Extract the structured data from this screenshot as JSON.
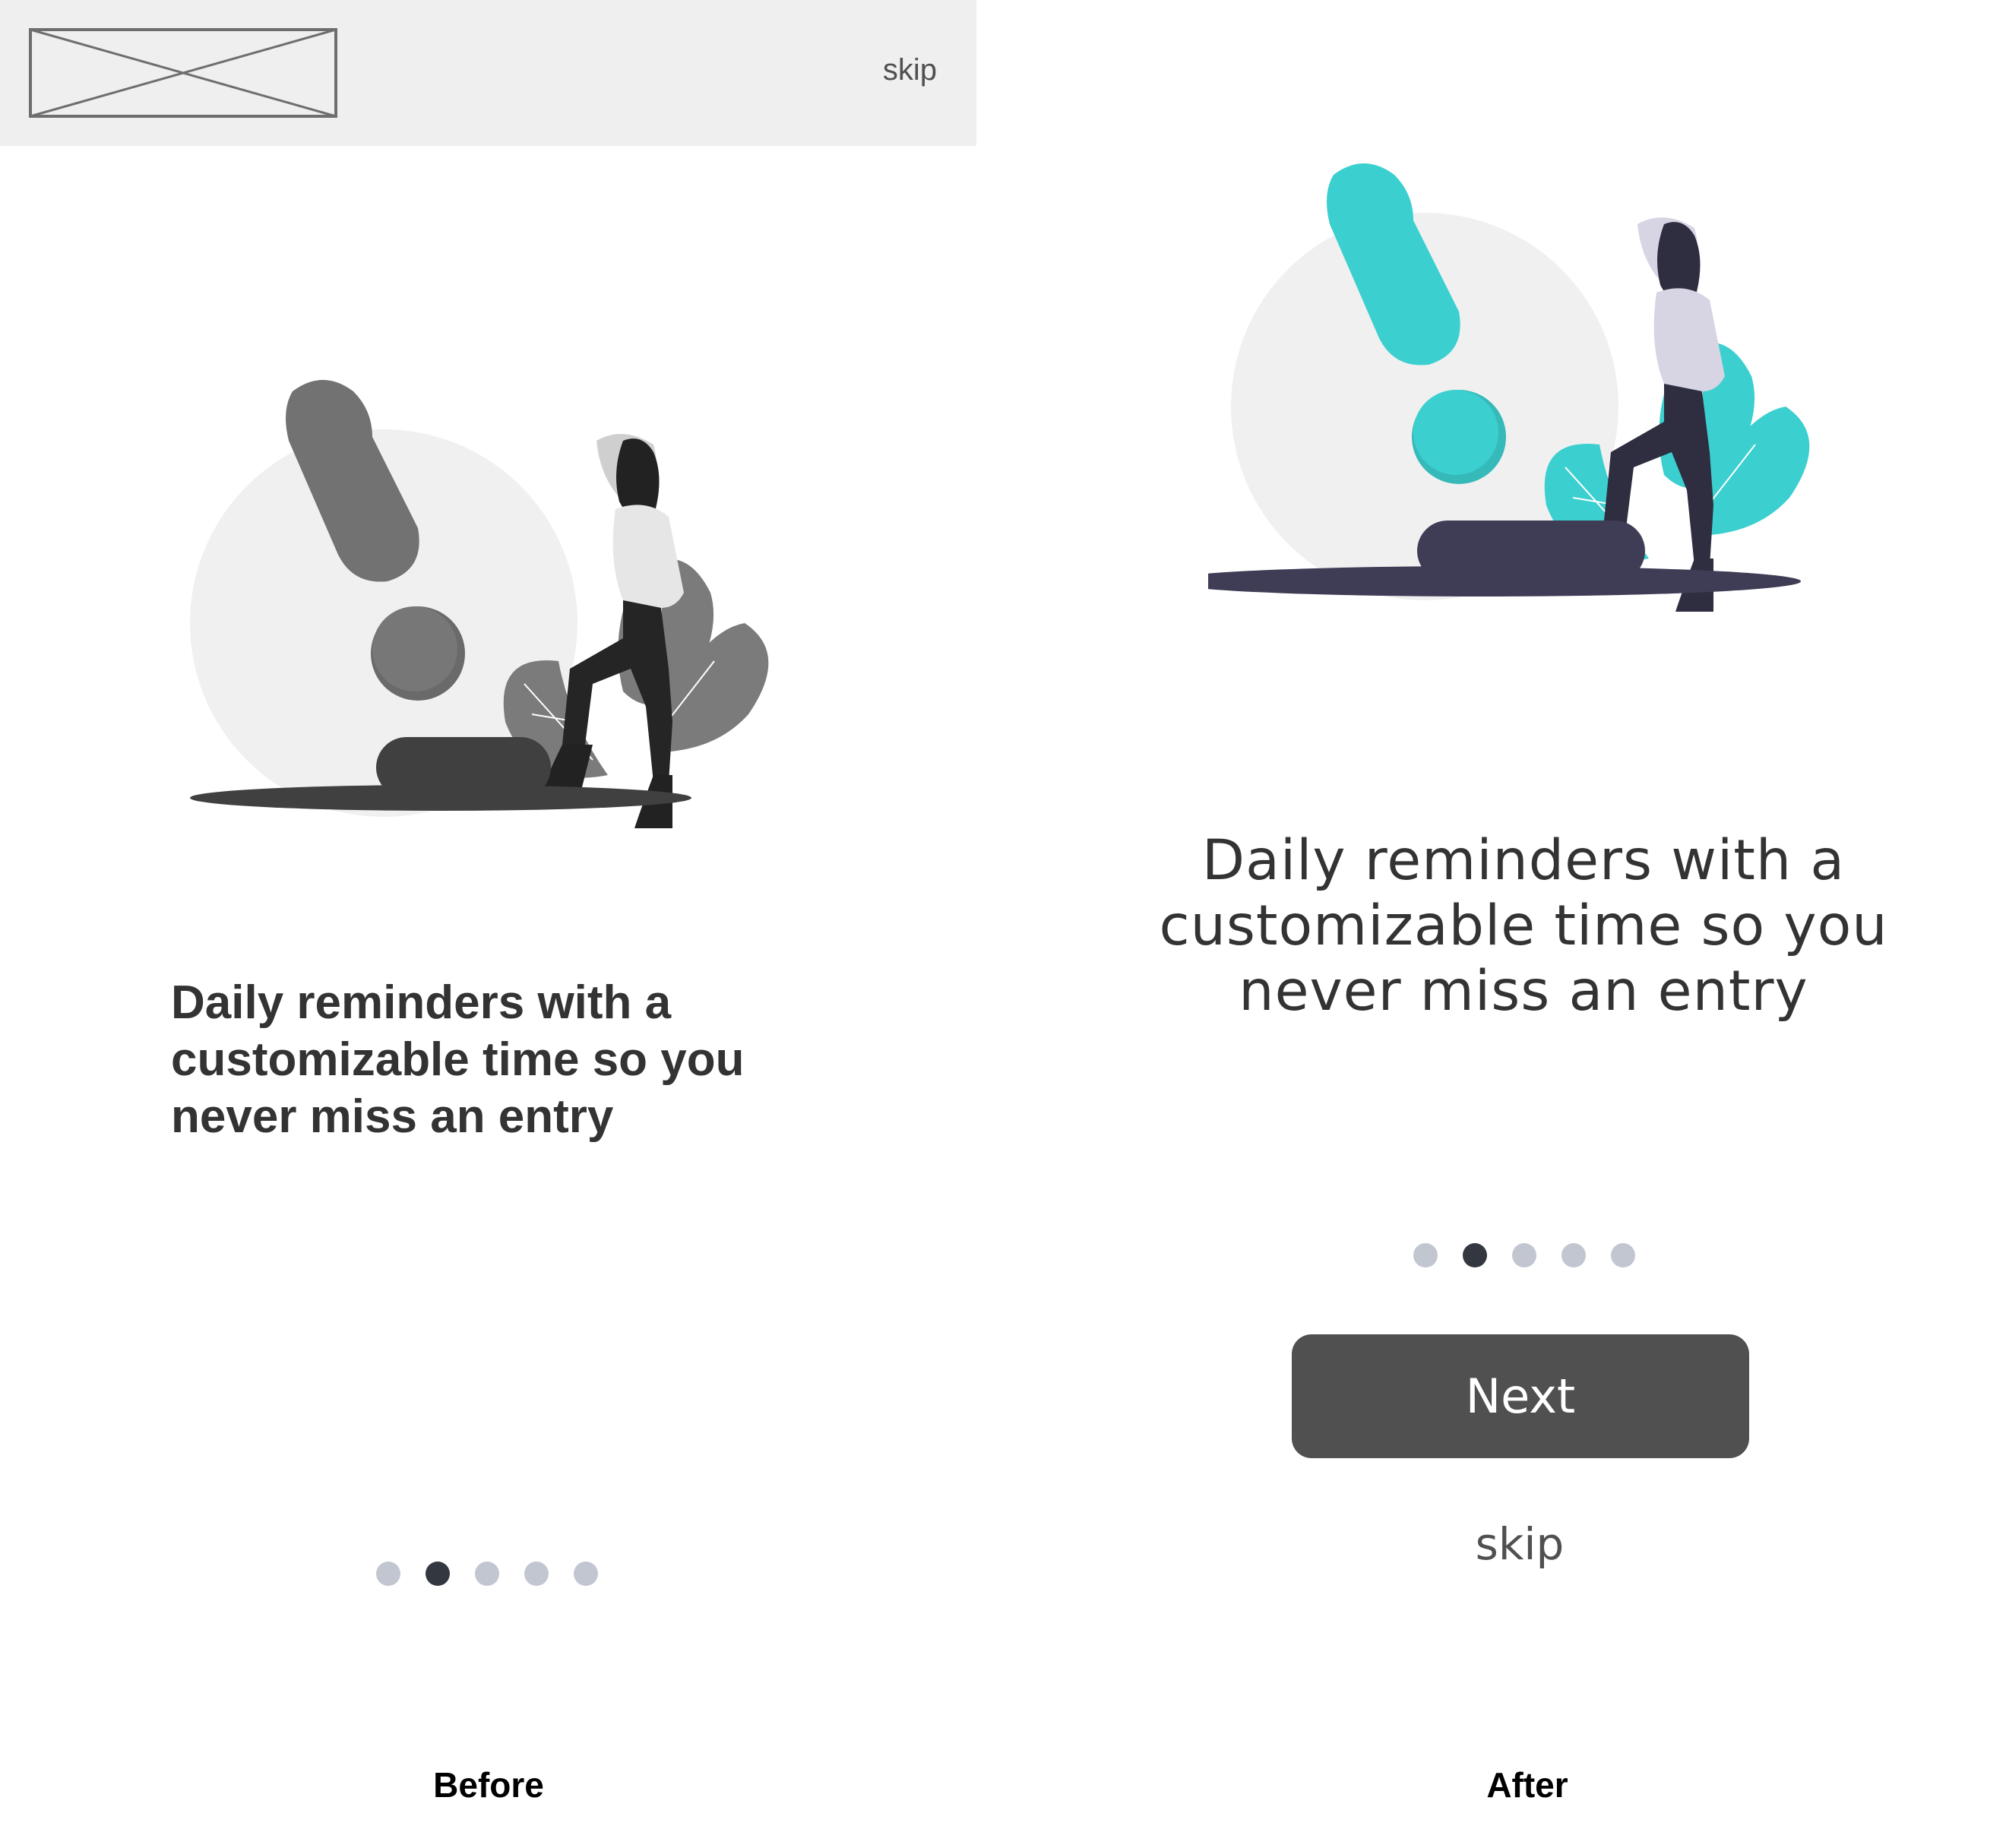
{
  "colors": {
    "header_bg": "#efefef",
    "text_dark": "#333333",
    "dot_inactive": "#c2c6d0",
    "dot_active": "#333840",
    "button_bg": "#505050",
    "accent_teal": "#3ccfcf",
    "shadow_dark": "#3f3d56",
    "grey_mark": "#727272"
  },
  "before": {
    "header": {
      "logo": "logo-placeholder-icon",
      "skip_label": "skip"
    },
    "illustration": "reminder-illustration-grayscale",
    "message": "Daily reminders with a customizable time so you never miss an entry",
    "pagination": {
      "total": 5,
      "active_index": 1
    },
    "caption": "Before"
  },
  "after": {
    "illustration": "reminder-illustration-color",
    "message": "Daily reminders with a customizable time so you never miss an entry",
    "pagination": {
      "total": 5,
      "active_index": 1
    },
    "next_label": "Next",
    "skip_label": "skip",
    "caption": "After"
  }
}
